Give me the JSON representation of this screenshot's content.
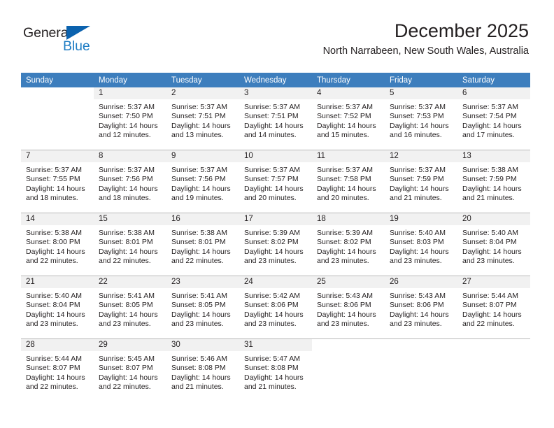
{
  "brand": {
    "name_part1": "General",
    "name_part2": "Blue"
  },
  "header": {
    "month_title": "December 2025",
    "location": "North Narrabeen, New South Wales, Australia",
    "accent_color": "#3d7ebd",
    "daynum_band_color": "#f1f1f1",
    "grid_line_color": "#b9b9b9"
  },
  "weekday_headers": [
    "Sunday",
    "Monday",
    "Tuesday",
    "Wednesday",
    "Thursday",
    "Friday",
    "Saturday"
  ],
  "weeks": [
    [
      {
        "day": "",
        "sunrise": "",
        "sunset": "",
        "daylight_line1": "",
        "daylight_line2": ""
      },
      {
        "day": "1",
        "sunrise": "Sunrise: 5:37 AM",
        "sunset": "Sunset: 7:50 PM",
        "daylight_line1": "Daylight: 14 hours",
        "daylight_line2": "and 12 minutes."
      },
      {
        "day": "2",
        "sunrise": "Sunrise: 5:37 AM",
        "sunset": "Sunset: 7:51 PM",
        "daylight_line1": "Daylight: 14 hours",
        "daylight_line2": "and 13 minutes."
      },
      {
        "day": "3",
        "sunrise": "Sunrise: 5:37 AM",
        "sunset": "Sunset: 7:51 PM",
        "daylight_line1": "Daylight: 14 hours",
        "daylight_line2": "and 14 minutes."
      },
      {
        "day": "4",
        "sunrise": "Sunrise: 5:37 AM",
        "sunset": "Sunset: 7:52 PM",
        "daylight_line1": "Daylight: 14 hours",
        "daylight_line2": "and 15 minutes."
      },
      {
        "day": "5",
        "sunrise": "Sunrise: 5:37 AM",
        "sunset": "Sunset: 7:53 PM",
        "daylight_line1": "Daylight: 14 hours",
        "daylight_line2": "and 16 minutes."
      },
      {
        "day": "6",
        "sunrise": "Sunrise: 5:37 AM",
        "sunset": "Sunset: 7:54 PM",
        "daylight_line1": "Daylight: 14 hours",
        "daylight_line2": "and 17 minutes."
      }
    ],
    [
      {
        "day": "7",
        "sunrise": "Sunrise: 5:37 AM",
        "sunset": "Sunset: 7:55 PM",
        "daylight_line1": "Daylight: 14 hours",
        "daylight_line2": "and 18 minutes."
      },
      {
        "day": "8",
        "sunrise": "Sunrise: 5:37 AM",
        "sunset": "Sunset: 7:56 PM",
        "daylight_line1": "Daylight: 14 hours",
        "daylight_line2": "and 18 minutes."
      },
      {
        "day": "9",
        "sunrise": "Sunrise: 5:37 AM",
        "sunset": "Sunset: 7:56 PM",
        "daylight_line1": "Daylight: 14 hours",
        "daylight_line2": "and 19 minutes."
      },
      {
        "day": "10",
        "sunrise": "Sunrise: 5:37 AM",
        "sunset": "Sunset: 7:57 PM",
        "daylight_line1": "Daylight: 14 hours",
        "daylight_line2": "and 20 minutes."
      },
      {
        "day": "11",
        "sunrise": "Sunrise: 5:37 AM",
        "sunset": "Sunset: 7:58 PM",
        "daylight_line1": "Daylight: 14 hours",
        "daylight_line2": "and 20 minutes."
      },
      {
        "day": "12",
        "sunrise": "Sunrise: 5:37 AM",
        "sunset": "Sunset: 7:59 PM",
        "daylight_line1": "Daylight: 14 hours",
        "daylight_line2": "and 21 minutes."
      },
      {
        "day": "13",
        "sunrise": "Sunrise: 5:38 AM",
        "sunset": "Sunset: 7:59 PM",
        "daylight_line1": "Daylight: 14 hours",
        "daylight_line2": "and 21 minutes."
      }
    ],
    [
      {
        "day": "14",
        "sunrise": "Sunrise: 5:38 AM",
        "sunset": "Sunset: 8:00 PM",
        "daylight_line1": "Daylight: 14 hours",
        "daylight_line2": "and 22 minutes."
      },
      {
        "day": "15",
        "sunrise": "Sunrise: 5:38 AM",
        "sunset": "Sunset: 8:01 PM",
        "daylight_line1": "Daylight: 14 hours",
        "daylight_line2": "and 22 minutes."
      },
      {
        "day": "16",
        "sunrise": "Sunrise: 5:38 AM",
        "sunset": "Sunset: 8:01 PM",
        "daylight_line1": "Daylight: 14 hours",
        "daylight_line2": "and 22 minutes."
      },
      {
        "day": "17",
        "sunrise": "Sunrise: 5:39 AM",
        "sunset": "Sunset: 8:02 PM",
        "daylight_line1": "Daylight: 14 hours",
        "daylight_line2": "and 23 minutes."
      },
      {
        "day": "18",
        "sunrise": "Sunrise: 5:39 AM",
        "sunset": "Sunset: 8:02 PM",
        "daylight_line1": "Daylight: 14 hours",
        "daylight_line2": "and 23 minutes."
      },
      {
        "day": "19",
        "sunrise": "Sunrise: 5:40 AM",
        "sunset": "Sunset: 8:03 PM",
        "daylight_line1": "Daylight: 14 hours",
        "daylight_line2": "and 23 minutes."
      },
      {
        "day": "20",
        "sunrise": "Sunrise: 5:40 AM",
        "sunset": "Sunset: 8:04 PM",
        "daylight_line1": "Daylight: 14 hours",
        "daylight_line2": "and 23 minutes."
      }
    ],
    [
      {
        "day": "21",
        "sunrise": "Sunrise: 5:40 AM",
        "sunset": "Sunset: 8:04 PM",
        "daylight_line1": "Daylight: 14 hours",
        "daylight_line2": "and 23 minutes."
      },
      {
        "day": "22",
        "sunrise": "Sunrise: 5:41 AM",
        "sunset": "Sunset: 8:05 PM",
        "daylight_line1": "Daylight: 14 hours",
        "daylight_line2": "and 23 minutes."
      },
      {
        "day": "23",
        "sunrise": "Sunrise: 5:41 AM",
        "sunset": "Sunset: 8:05 PM",
        "daylight_line1": "Daylight: 14 hours",
        "daylight_line2": "and 23 minutes."
      },
      {
        "day": "24",
        "sunrise": "Sunrise: 5:42 AM",
        "sunset": "Sunset: 8:06 PM",
        "daylight_line1": "Daylight: 14 hours",
        "daylight_line2": "and 23 minutes."
      },
      {
        "day": "25",
        "sunrise": "Sunrise: 5:43 AM",
        "sunset": "Sunset: 8:06 PM",
        "daylight_line1": "Daylight: 14 hours",
        "daylight_line2": "and 23 minutes."
      },
      {
        "day": "26",
        "sunrise": "Sunrise: 5:43 AM",
        "sunset": "Sunset: 8:06 PM",
        "daylight_line1": "Daylight: 14 hours",
        "daylight_line2": "and 23 minutes."
      },
      {
        "day": "27",
        "sunrise": "Sunrise: 5:44 AM",
        "sunset": "Sunset: 8:07 PM",
        "daylight_line1": "Daylight: 14 hours",
        "daylight_line2": "and 22 minutes."
      }
    ],
    [
      {
        "day": "28",
        "sunrise": "Sunrise: 5:44 AM",
        "sunset": "Sunset: 8:07 PM",
        "daylight_line1": "Daylight: 14 hours",
        "daylight_line2": "and 22 minutes."
      },
      {
        "day": "29",
        "sunrise": "Sunrise: 5:45 AM",
        "sunset": "Sunset: 8:07 PM",
        "daylight_line1": "Daylight: 14 hours",
        "daylight_line2": "and 22 minutes."
      },
      {
        "day": "30",
        "sunrise": "Sunrise: 5:46 AM",
        "sunset": "Sunset: 8:08 PM",
        "daylight_line1": "Daylight: 14 hours",
        "daylight_line2": "and 21 minutes."
      },
      {
        "day": "31",
        "sunrise": "Sunrise: 5:47 AM",
        "sunset": "Sunset: 8:08 PM",
        "daylight_line1": "Daylight: 14 hours",
        "daylight_line2": "and 21 minutes."
      },
      {
        "day": "",
        "sunrise": "",
        "sunset": "",
        "daylight_line1": "",
        "daylight_line2": ""
      },
      {
        "day": "",
        "sunrise": "",
        "sunset": "",
        "daylight_line1": "",
        "daylight_line2": ""
      },
      {
        "day": "",
        "sunrise": "",
        "sunset": "",
        "daylight_line1": "",
        "daylight_line2": ""
      }
    ]
  ]
}
